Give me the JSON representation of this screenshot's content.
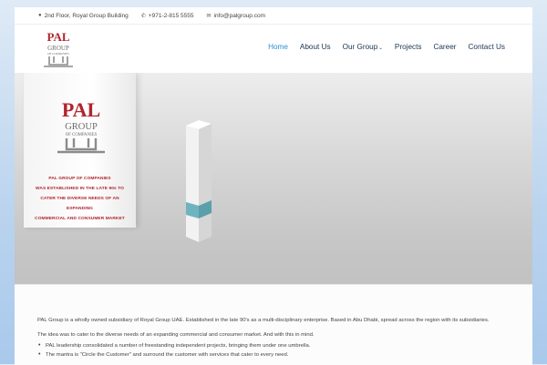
{
  "topbar": {
    "address": "2nd Floor, Royal Group Building",
    "phone": "+971-2-815 5555",
    "email": "info@palgroup.com"
  },
  "logo": {
    "main": "PAL",
    "sub1": "GROUP",
    "sub2": "OF COMPANIES"
  },
  "nav": {
    "items": [
      {
        "label": "Home",
        "active": true
      },
      {
        "label": "About Us"
      },
      {
        "label": "Our Group",
        "dropdown": true
      },
      {
        "label": "Projects"
      },
      {
        "label": "Career"
      },
      {
        "label": "Contact Us"
      }
    ]
  },
  "hero": {
    "lines": [
      "PAL GROUP OF COMPANIES",
      "WAS ESTABLISHED IN THE LATE 90s TO",
      "CATER THE DIVERSE NEEDS OF AN EXPANDING",
      "COMMERCIAL AND CONSUMER MARKET"
    ]
  },
  "content": {
    "p1": "PAL Group is a wholly owned subsidiary of Royal Group UAE. Established in the late 90's as a multi-disciplinary enterprise. Based in Abu Dhabi, spread across the region with its subsidiaries.",
    "p2": "The idea was to cater to the diverse needs of an expanding commercial and consumer market. And with this in mind.",
    "bullets": [
      "PAL leadership consolidated a number of freestanding independent projects, bringing them under one umbrella.",
      "The mantra is \"Circle the Customer\" and surround the customer with services that cater to every need."
    ]
  },
  "colors": {
    "brand_red": "#b0242d",
    "nav_active": "#2f8fd1",
    "nav_text": "#1a3550",
    "accent_teal": "#6fb3be"
  }
}
